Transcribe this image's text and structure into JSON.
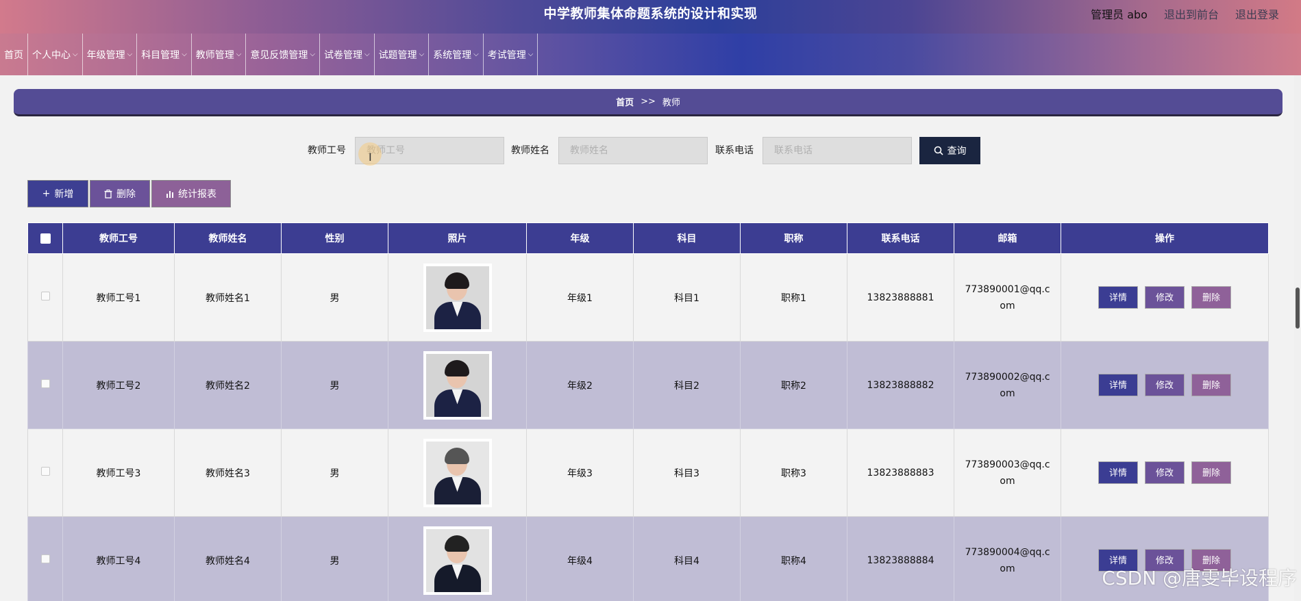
{
  "header": {
    "title": "中学教师集体命题系统的设计和实现",
    "admin": "管理员 abo",
    "back_to_front": "退出到前台",
    "logout": "退出登录"
  },
  "nav": {
    "items": [
      {
        "label": "首页",
        "has_dropdown": false
      },
      {
        "label": "个人中心",
        "has_dropdown": true
      },
      {
        "label": "年级管理",
        "has_dropdown": true
      },
      {
        "label": "科目管理",
        "has_dropdown": true
      },
      {
        "label": "教师管理",
        "has_dropdown": true
      },
      {
        "label": "意见反馈管理",
        "has_dropdown": true
      },
      {
        "label": "试卷管理",
        "has_dropdown": true
      },
      {
        "label": "试题管理",
        "has_dropdown": true
      },
      {
        "label": "系统管理",
        "has_dropdown": true
      },
      {
        "label": "考试管理",
        "has_dropdown": true
      }
    ]
  },
  "breadcrumb": {
    "home": "首页",
    "separator": ">>",
    "current": "教师"
  },
  "search": {
    "teacher_id_label": "教师工号",
    "teacher_id_placeholder": "教师工号",
    "teacher_name_label": "教师姓名",
    "teacher_name_placeholder": "教师姓名",
    "phone_label": "联系电话",
    "phone_placeholder": "联系电话",
    "query_button": "查询"
  },
  "actions": {
    "add": "新增",
    "delete": "删除",
    "report": "统计报表"
  },
  "table": {
    "columns": [
      "教师工号",
      "教师姓名",
      "性别",
      "照片",
      "年级",
      "科目",
      "职称",
      "联系电话",
      "邮箱",
      "操作"
    ],
    "rows": [
      {
        "id": "教师工号1",
        "name": "教师姓名1",
        "gender": "男",
        "grade": "年级1",
        "subject": "科目1",
        "title": "职称1",
        "phone": "13823888881",
        "email": "773890001@qq.com"
      },
      {
        "id": "教师工号2",
        "name": "教师姓名2",
        "gender": "男",
        "grade": "年级2",
        "subject": "科目2",
        "title": "职称2",
        "phone": "13823888882",
        "email": "773890002@qq.com"
      },
      {
        "id": "教师工号3",
        "name": "教师姓名3",
        "gender": "男",
        "grade": "年级3",
        "subject": "科目3",
        "title": "职称3",
        "phone": "13823888883",
        "email": "773890003@qq.com"
      },
      {
        "id": "教师工号4",
        "name": "教师姓名4",
        "gender": "男",
        "grade": "年级4",
        "subject": "科目4",
        "title": "职称4",
        "phone": "13823888884",
        "email": "773890004@qq.com"
      }
    ],
    "row_buttons": {
      "detail": "详情",
      "edit": "修改",
      "delete": "删除"
    }
  },
  "watermark": "CSDN @唐雯毕设程序"
}
